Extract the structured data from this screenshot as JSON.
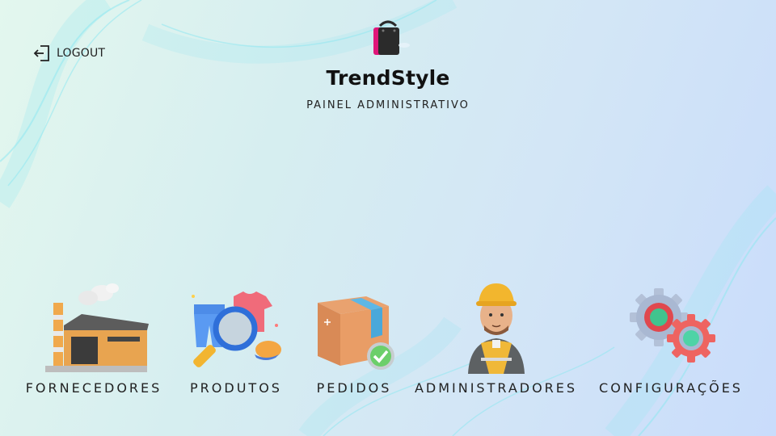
{
  "header": {
    "logout_label": "LOGOUT",
    "brand_name": "TrendStyle",
    "brand_subtitle": "PAINEL ADMINISTRATIVO"
  },
  "menu": {
    "items": [
      {
        "label": "FORNECEDORES",
        "icon": "factory-icon"
      },
      {
        "label": "PRODUTOS",
        "icon": "products-search-icon"
      },
      {
        "label": "PEDIDOS",
        "icon": "package-check-icon"
      },
      {
        "label": "ADMINISTRADORES",
        "icon": "worker-icon"
      },
      {
        "label": "CONFIGURAÇÕES",
        "icon": "gears-icon"
      }
    ]
  },
  "colors": {
    "brand_pink": "#e0167a",
    "bag_dark": "#2b2b2b",
    "text": "#222222"
  }
}
